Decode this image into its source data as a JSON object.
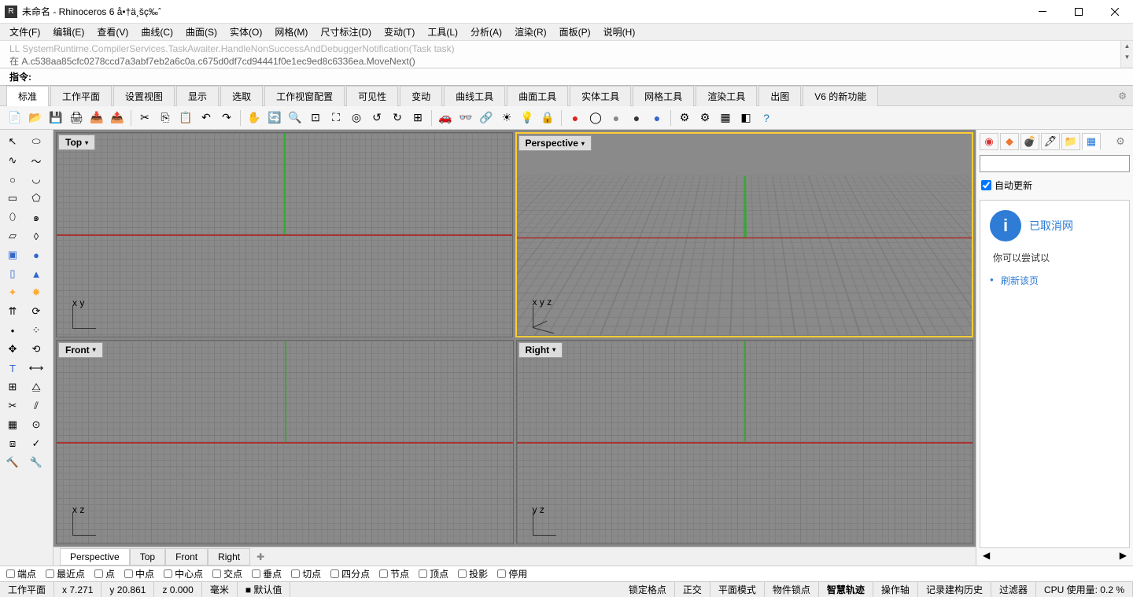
{
  "window": {
    "title": "未命名 - Rhinoceros 6 å•†ä¸šç‰ˆ"
  },
  "menus": [
    "文件(F)",
    "编辑(E)",
    "查看(V)",
    "曲线(C)",
    "曲面(S)",
    "实体(O)",
    "网格(M)",
    "尺寸标注(D)",
    "变动(T)",
    "工具(L)",
    "分析(A)",
    "渲染(R)",
    "面板(P)",
    "说明(H)"
  ],
  "log": {
    "line1": "LL SystemRuntime.CompilerServices.TaskAwaiter.HandleNonSuccessAndDebuggerNotification(Task task)",
    "line2": "在 A.c538aa85cfc0278ccd7a3abf7eb2a6c0a.c675d0df7cd94441f0e1ec9ed8c6336ea.MoveNext()"
  },
  "cmd": {
    "prompt": "指令:"
  },
  "tabs": [
    "标准",
    "工作平面",
    "设置视图",
    "显示",
    "选取",
    "工作视窗配置",
    "可见性",
    "变动",
    "曲线工具",
    "曲面工具",
    "实体工具",
    "网格工具",
    "渲染工具",
    "出图",
    "V6 的新功能"
  ],
  "viewports": {
    "top": "Top",
    "perspective": "Perspective",
    "front": "Front",
    "right": "Right",
    "axes": {
      "x": "x",
      "y": "y",
      "z": "z"
    }
  },
  "rpanel": {
    "auto_update": "自动更新",
    "info_title": "已取消网",
    "info_text": "你可以尝试以",
    "info_link": "刷新该页"
  },
  "vptabs": [
    "Perspective",
    "Top",
    "Front",
    "Right"
  ],
  "osnap": [
    "端点",
    "最近点",
    "点",
    "中点",
    "中心点",
    "交点",
    "垂点",
    "切点",
    "四分点",
    "节点",
    "顶点",
    "投影",
    "停用"
  ],
  "status": {
    "cplane": "工作平面",
    "x": "x 7.271",
    "y": "y 20.861",
    "z": "z 0.000",
    "unit": "毫米",
    "layer_icon": "■",
    "layer": "默认值",
    "cells": [
      "锁定格点",
      "正交",
      "平面模式",
      "物件锁点",
      "智慧轨迹",
      "操作轴",
      "记录建构历史",
      "过滤器"
    ],
    "cpu": "CPU 使用量: 0.2 %"
  }
}
